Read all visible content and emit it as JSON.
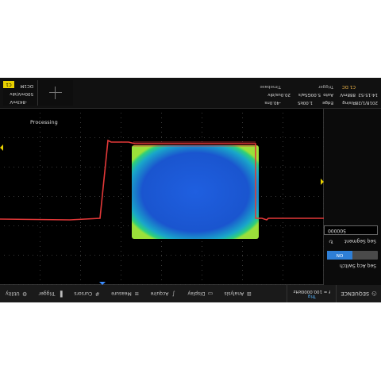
{
  "menu": {
    "sequence_label": "SEQUENCE",
    "trig_label": "Trig",
    "trig_frequency": "f = 100.0000kHz",
    "items": [
      {
        "label": "Analysis",
        "icon": "analysis-icon"
      },
      {
        "label": "Display",
        "icon": "display-icon"
      },
      {
        "label": "Acquire",
        "icon": "acquire-icon"
      },
      {
        "label": "Measure",
        "icon": "measure-icon"
      },
      {
        "label": "Cursors",
        "icon": "cursors-icon"
      },
      {
        "label": "Trigger",
        "icon": "trigger-icon"
      },
      {
        "label": "Utility",
        "icon": "utility-icon"
      }
    ]
  },
  "panel": {
    "seq_acq_switch_label": "Seq Acq Switch",
    "switch_state": "ON",
    "seq_segment_label": "Seq Segment",
    "seq_segment_value": "500000"
  },
  "waveform": {
    "processing_label": "Processing"
  },
  "info": {
    "timebase_label": "Timebase",
    "timebase_value": "20.0us/div",
    "delay_value": "-40.0ns",
    "sample_rate": "5.00GSa/s",
    "record_length": "1.00kS",
    "trigger_label": "Trigger",
    "trigger_source": "C1 DC",
    "trigger_mode": "Auto",
    "trigger_level": "888mV",
    "trigger_type": "Edge",
    "trigger_slope": "Rising",
    "date": "2018/1/28",
    "time": "14:15:52",
    "channel_badge": "C1",
    "channel_coupling": "DC1M",
    "channel_scale": "500mV/div",
    "channel_offset": "-843mV"
  },
  "colors": {
    "accent": "#2e7fd7",
    "trace": "#e23838",
    "channel": "#e8d000"
  }
}
